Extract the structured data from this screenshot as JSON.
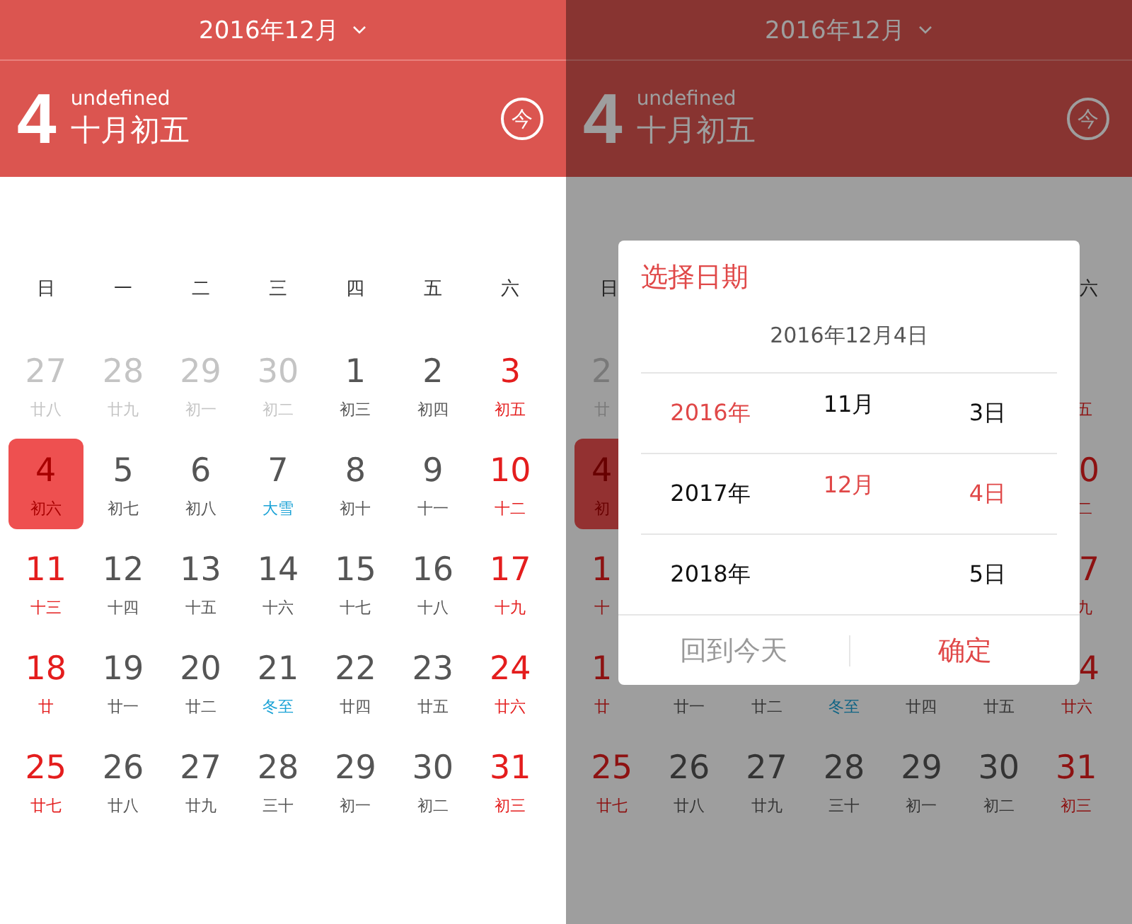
{
  "screens": [
    {
      "dimmed": false,
      "header": {
        "title": "2016年12月"
      },
      "today": {
        "day": "4",
        "note": "undefined",
        "lunar": "十月初五",
        "button": "今"
      },
      "calendar": {
        "weekdays": [
          "日",
          "一",
          "二",
          "三",
          "四",
          "五",
          "六"
        ],
        "weeks": [
          [
            {
              "day": "27",
              "lunar": "廿八",
              "kind": "outside",
              "selected": false
            },
            {
              "day": "28",
              "lunar": "廿九",
              "kind": "outside",
              "selected": false
            },
            {
              "day": "29",
              "lunar": "初一",
              "kind": "outside",
              "selected": false
            },
            {
              "day": "30",
              "lunar": "初二",
              "kind": "outside",
              "selected": false
            },
            {
              "day": "1",
              "lunar": "初三",
              "kind": "weekday",
              "selected": false
            },
            {
              "day": "2",
              "lunar": "初四",
              "kind": "weekday",
              "selected": false
            },
            {
              "day": "3",
              "lunar": "初五",
              "kind": "weekend",
              "selected": false
            }
          ],
          [
            {
              "day": "4",
              "lunar": "初六",
              "kind": "weekend",
              "selected": true
            },
            {
              "day": "5",
              "lunar": "初七",
              "kind": "weekday",
              "selected": false
            },
            {
              "day": "6",
              "lunar": "初八",
              "kind": "weekday",
              "selected": false
            },
            {
              "day": "7",
              "lunar": "大雪",
              "kind": "term",
              "selected": false
            },
            {
              "day": "8",
              "lunar": "初十",
              "kind": "weekday",
              "selected": false
            },
            {
              "day": "9",
              "lunar": "十一",
              "kind": "weekday",
              "selected": false
            },
            {
              "day": "10",
              "lunar": "十二",
              "kind": "weekend",
              "selected": false
            }
          ],
          [
            {
              "day": "11",
              "lunar": "十三",
              "kind": "weekend",
              "selected": false
            },
            {
              "day": "12",
              "lunar": "十四",
              "kind": "weekday",
              "selected": false
            },
            {
              "day": "13",
              "lunar": "十五",
              "kind": "weekday",
              "selected": false
            },
            {
              "day": "14",
              "lunar": "十六",
              "kind": "weekday",
              "selected": false
            },
            {
              "day": "15",
              "lunar": "十七",
              "kind": "weekday",
              "selected": false
            },
            {
              "day": "16",
              "lunar": "十八",
              "kind": "weekday",
              "selected": false
            },
            {
              "day": "17",
              "lunar": "十九",
              "kind": "weekend",
              "selected": false
            }
          ],
          [
            {
              "day": "18",
              "lunar": "廿",
              "kind": "weekend",
              "selected": false
            },
            {
              "day": "19",
              "lunar": "廿一",
              "kind": "weekday",
              "selected": false
            },
            {
              "day": "20",
              "lunar": "廿二",
              "kind": "weekday",
              "selected": false
            },
            {
              "day": "21",
              "lunar": "冬至",
              "kind": "term",
              "selected": false
            },
            {
              "day": "22",
              "lunar": "廿四",
              "kind": "weekday",
              "selected": false
            },
            {
              "day": "23",
              "lunar": "廿五",
              "kind": "weekday",
              "selected": false
            },
            {
              "day": "24",
              "lunar": "廿六",
              "kind": "weekend",
              "selected": false
            }
          ],
          [
            {
              "day": "25",
              "lunar": "廿七",
              "kind": "weekend",
              "selected": false
            },
            {
              "day": "26",
              "lunar": "廿八",
              "kind": "weekday",
              "selected": false
            },
            {
              "day": "27",
              "lunar": "廿九",
              "kind": "weekday",
              "selected": false
            },
            {
              "day": "28",
              "lunar": "三十",
              "kind": "weekday",
              "selected": false
            },
            {
              "day": "29",
              "lunar": "初一",
              "kind": "weekday",
              "selected": false
            },
            {
              "day": "30",
              "lunar": "初二",
              "kind": "weekday",
              "selected": false
            },
            {
              "day": "31",
              "lunar": "初三",
              "kind": "weekend",
              "selected": false
            }
          ]
        ]
      }
    },
    {
      "dimmed": true,
      "header": {
        "title": "2016年12月"
      },
      "today": {
        "day": "4",
        "note": "undefined",
        "lunar": "十月初五",
        "button": "今"
      },
      "calendar": {
        "weekdays": {
          "left": "日",
          "right": "六"
        },
        "weeks": [
          {
            "left": {
              "day": "2",
              "lunar": "廿",
              "kind": "outside",
              "selected": false
            },
            "right": {
              "lunar": "五",
              "kind": "weekend",
              "selected": false
            }
          },
          {
            "left": {
              "day": "4",
              "lunar": "初",
              "kind": "weekend",
              "selected": true
            },
            "right": {
              "day": "0",
              "lunar": "二",
              "kind": "weekend",
              "selected": false
            }
          },
          {
            "left": {
              "day": "1",
              "lunar": "十",
              "kind": "weekend",
              "selected": false
            },
            "right": {
              "day": "7",
              "lunar": "九",
              "kind": "weekend",
              "selected": false
            }
          },
          {
            "left": {
              "day": "1",
              "lunar": "廿",
              "kind": "weekend",
              "selected": false
            },
            "middle": [
              {
                "lunar": "廿一",
                "kind": "weekday",
                "selected": false
              },
              {
                "lunar": "廿二",
                "kind": "weekday",
                "selected": false
              },
              {
                "lunar": "冬至",
                "kind": "term",
                "selected": false
              },
              {
                "lunar": "廿四",
                "kind": "weekday",
                "selected": false
              },
              {
                "lunar": "廿五",
                "kind": "weekday",
                "selected": false
              }
            ],
            "right": {
              "day": "4",
              "lunar": "廿六",
              "kind": "weekend",
              "selected": false
            }
          },
          [
            {
              "day": "25",
              "lunar": "廿七",
              "kind": "weekend",
              "selected": false
            },
            {
              "day": "26",
              "lunar": "廿八",
              "kind": "weekday",
              "selected": false
            },
            {
              "day": "27",
              "lunar": "廿九",
              "kind": "weekday",
              "selected": false
            },
            {
              "day": "28",
              "lunar": "三十",
              "kind": "weekday",
              "selected": false
            },
            {
              "day": "29",
              "lunar": "初一",
              "kind": "weekday",
              "selected": false
            },
            {
              "day": "30",
              "lunar": "初二",
              "kind": "weekday",
              "selected": false
            },
            {
              "day": "31",
              "lunar": "初三",
              "kind": "weekend",
              "selected": false
            }
          ]
        ]
      },
      "dialog": {
        "title": "选择日期",
        "date": "2016年12月4日",
        "columns": [
          [
            {
              "label": "2016年",
              "selected": true
            },
            {
              "label": "2017年",
              "selected": false
            },
            {
              "label": "2018年",
              "selected": false
            }
          ],
          [
            {
              "label": "11月",
              "selected": false
            },
            {
              "label": "12月",
              "selected": true
            }
          ],
          [
            {
              "label": "3日",
              "selected": false
            },
            {
              "label": "4日",
              "selected": true
            },
            {
              "label": "5日",
              "selected": false
            }
          ]
        ],
        "buttons": [
          "回到今天",
          "确定"
        ]
      }
    }
  ]
}
